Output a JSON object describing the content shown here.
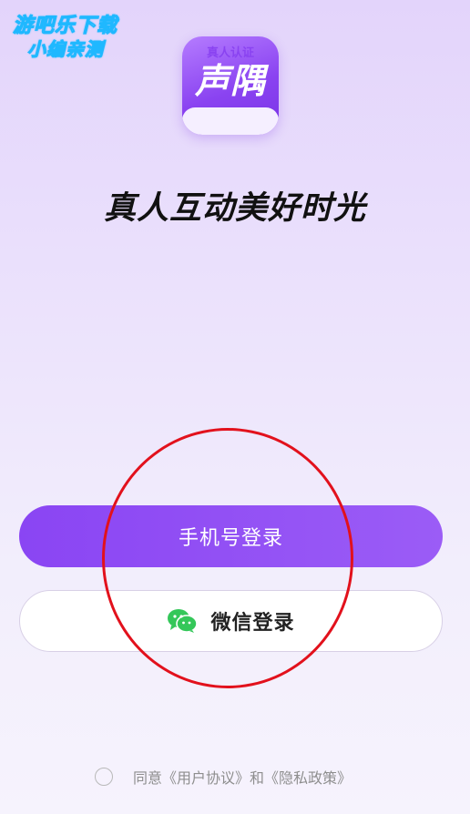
{
  "watermark": {
    "line1": "游吧乐下载",
    "line2": "小编亲测"
  },
  "app": {
    "icon_name": "声隅",
    "icon_badge": "真人认证",
    "slogan": "真人互动美好时光"
  },
  "login": {
    "phone_label": "手机号登录",
    "wechat_label": "微信登录"
  },
  "agreement": {
    "prefix": "同意",
    "user_agreement": "《用户协议》",
    "conjunction": "和",
    "privacy_policy": "《隐私政策》"
  },
  "colors": {
    "accent": "#8a45f3",
    "annotation": "#e2111c",
    "wechat_green": "#34c759"
  }
}
